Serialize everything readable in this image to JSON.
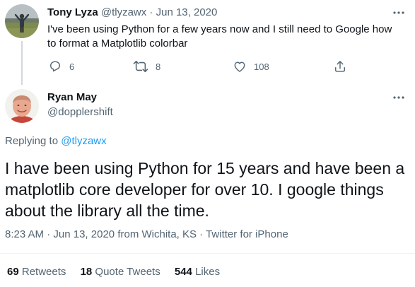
{
  "parent_tweet": {
    "name": "Tony Lyza",
    "handle": "@tlyzawx",
    "separator": " · ",
    "date": "Jun 13, 2020",
    "text": "I've been using Python for a few years now and I still need to Google how to format a Matplotlib colorbar",
    "actions": {
      "reply_count": "6",
      "retweet_count": "8",
      "like_count": "108"
    },
    "icons": [
      "reply-icon",
      "retweet-icon",
      "like-icon",
      "share-icon",
      "more-icon"
    ]
  },
  "main_tweet": {
    "name": "Ryan May",
    "handle": "@dopplershift",
    "replying_prefix": "Replying to ",
    "replying_handle": "@tlyzawx",
    "text": "I have been using Python for 15 years and have been a matplotlib core developer for over 10. I google things about the library all the time.",
    "meta": {
      "time": "8:23 AM",
      "separator": " · ",
      "date": "Jun 13, 2020",
      "location": "from Wichita, KS",
      "source": "Twitter for iPhone"
    },
    "stats": {
      "retweets_count": "69",
      "retweets_label": "Retweets",
      "quotes_count": "18",
      "quotes_label": "Quote Tweets",
      "likes_count": "544",
      "likes_label": "Likes"
    }
  },
  "colors": {
    "text_primary": "#0f1419",
    "text_secondary": "#536471",
    "link": "#1d9bf0",
    "divider": "#eff3f4",
    "thread_line": "#cfd9de"
  }
}
